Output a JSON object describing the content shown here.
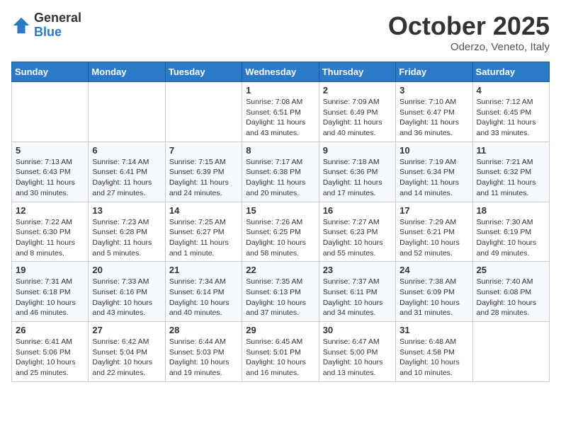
{
  "logo": {
    "general": "General",
    "blue": "Blue"
  },
  "header": {
    "month": "October 2025",
    "location": "Oderzo, Veneto, Italy"
  },
  "weekdays": [
    "Sunday",
    "Monday",
    "Tuesday",
    "Wednesday",
    "Thursday",
    "Friday",
    "Saturday"
  ],
  "weeks": [
    [
      {
        "day": "",
        "info": ""
      },
      {
        "day": "",
        "info": ""
      },
      {
        "day": "",
        "info": ""
      },
      {
        "day": "1",
        "info": "Sunrise: 7:08 AM\nSunset: 6:51 PM\nDaylight: 11 hours\nand 43 minutes."
      },
      {
        "day": "2",
        "info": "Sunrise: 7:09 AM\nSunset: 6:49 PM\nDaylight: 11 hours\nand 40 minutes."
      },
      {
        "day": "3",
        "info": "Sunrise: 7:10 AM\nSunset: 6:47 PM\nDaylight: 11 hours\nand 36 minutes."
      },
      {
        "day": "4",
        "info": "Sunrise: 7:12 AM\nSunset: 6:45 PM\nDaylight: 11 hours\nand 33 minutes."
      }
    ],
    [
      {
        "day": "5",
        "info": "Sunrise: 7:13 AM\nSunset: 6:43 PM\nDaylight: 11 hours\nand 30 minutes."
      },
      {
        "day": "6",
        "info": "Sunrise: 7:14 AM\nSunset: 6:41 PM\nDaylight: 11 hours\nand 27 minutes."
      },
      {
        "day": "7",
        "info": "Sunrise: 7:15 AM\nSunset: 6:39 PM\nDaylight: 11 hours\nand 24 minutes."
      },
      {
        "day": "8",
        "info": "Sunrise: 7:17 AM\nSunset: 6:38 PM\nDaylight: 11 hours\nand 20 minutes."
      },
      {
        "day": "9",
        "info": "Sunrise: 7:18 AM\nSunset: 6:36 PM\nDaylight: 11 hours\nand 17 minutes."
      },
      {
        "day": "10",
        "info": "Sunrise: 7:19 AM\nSunset: 6:34 PM\nDaylight: 11 hours\nand 14 minutes."
      },
      {
        "day": "11",
        "info": "Sunrise: 7:21 AM\nSunset: 6:32 PM\nDaylight: 11 hours\nand 11 minutes."
      }
    ],
    [
      {
        "day": "12",
        "info": "Sunrise: 7:22 AM\nSunset: 6:30 PM\nDaylight: 11 hours\nand 8 minutes."
      },
      {
        "day": "13",
        "info": "Sunrise: 7:23 AM\nSunset: 6:28 PM\nDaylight: 11 hours\nand 5 minutes."
      },
      {
        "day": "14",
        "info": "Sunrise: 7:25 AM\nSunset: 6:27 PM\nDaylight: 11 hours\nand 1 minute."
      },
      {
        "day": "15",
        "info": "Sunrise: 7:26 AM\nSunset: 6:25 PM\nDaylight: 10 hours\nand 58 minutes."
      },
      {
        "day": "16",
        "info": "Sunrise: 7:27 AM\nSunset: 6:23 PM\nDaylight: 10 hours\nand 55 minutes."
      },
      {
        "day": "17",
        "info": "Sunrise: 7:29 AM\nSunset: 6:21 PM\nDaylight: 10 hours\nand 52 minutes."
      },
      {
        "day": "18",
        "info": "Sunrise: 7:30 AM\nSunset: 6:19 PM\nDaylight: 10 hours\nand 49 minutes."
      }
    ],
    [
      {
        "day": "19",
        "info": "Sunrise: 7:31 AM\nSunset: 6:18 PM\nDaylight: 10 hours\nand 46 minutes."
      },
      {
        "day": "20",
        "info": "Sunrise: 7:33 AM\nSunset: 6:16 PM\nDaylight: 10 hours\nand 43 minutes."
      },
      {
        "day": "21",
        "info": "Sunrise: 7:34 AM\nSunset: 6:14 PM\nDaylight: 10 hours\nand 40 minutes."
      },
      {
        "day": "22",
        "info": "Sunrise: 7:35 AM\nSunset: 6:13 PM\nDaylight: 10 hours\nand 37 minutes."
      },
      {
        "day": "23",
        "info": "Sunrise: 7:37 AM\nSunset: 6:11 PM\nDaylight: 10 hours\nand 34 minutes."
      },
      {
        "day": "24",
        "info": "Sunrise: 7:38 AM\nSunset: 6:09 PM\nDaylight: 10 hours\nand 31 minutes."
      },
      {
        "day": "25",
        "info": "Sunrise: 7:40 AM\nSunset: 6:08 PM\nDaylight: 10 hours\nand 28 minutes."
      }
    ],
    [
      {
        "day": "26",
        "info": "Sunrise: 6:41 AM\nSunset: 5:06 PM\nDaylight: 10 hours\nand 25 minutes."
      },
      {
        "day": "27",
        "info": "Sunrise: 6:42 AM\nSunset: 5:04 PM\nDaylight: 10 hours\nand 22 minutes."
      },
      {
        "day": "28",
        "info": "Sunrise: 6:44 AM\nSunset: 5:03 PM\nDaylight: 10 hours\nand 19 minutes."
      },
      {
        "day": "29",
        "info": "Sunrise: 6:45 AM\nSunset: 5:01 PM\nDaylight: 10 hours\nand 16 minutes."
      },
      {
        "day": "30",
        "info": "Sunrise: 6:47 AM\nSunset: 5:00 PM\nDaylight: 10 hours\nand 13 minutes."
      },
      {
        "day": "31",
        "info": "Sunrise: 6:48 AM\nSunset: 4:58 PM\nDaylight: 10 hours\nand 10 minutes."
      },
      {
        "day": "",
        "info": ""
      }
    ]
  ]
}
